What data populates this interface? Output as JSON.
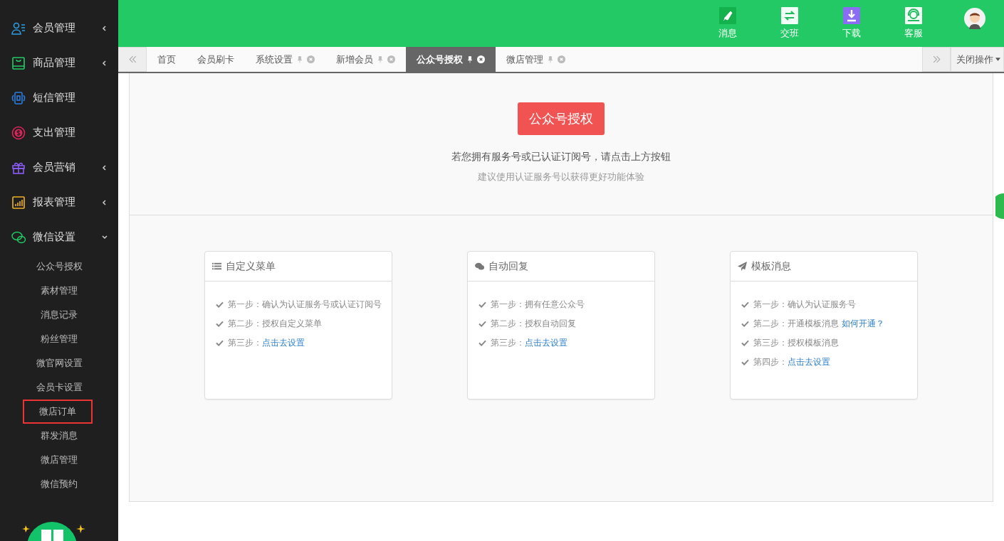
{
  "sidebar": {
    "items": [
      {
        "label": "会员管理",
        "submenu": true,
        "expanded": false
      },
      {
        "label": "商品管理",
        "submenu": true,
        "expanded": false
      },
      {
        "label": "短信管理",
        "submenu": false
      },
      {
        "label": "支出管理",
        "submenu": false
      },
      {
        "label": "会员营销",
        "submenu": true,
        "expanded": false
      },
      {
        "label": "报表管理",
        "submenu": true,
        "expanded": false
      },
      {
        "label": "微信设置",
        "submenu": true,
        "expanded": true,
        "children": [
          {
            "label": "公众号授权",
            "highlighted": false
          },
          {
            "label": "素材管理",
            "highlighted": false
          },
          {
            "label": "消息记录",
            "highlighted": false
          },
          {
            "label": "粉丝管理",
            "highlighted": false
          },
          {
            "label": "微官网设置",
            "highlighted": false
          },
          {
            "label": "会员卡设置",
            "highlighted": false
          },
          {
            "label": "微店订单",
            "highlighted": true
          },
          {
            "label": "群发消息",
            "highlighted": false
          },
          {
            "label": "微店管理",
            "highlighted": false
          },
          {
            "label": "微信预约",
            "highlighted": false
          }
        ]
      }
    ]
  },
  "topbar": {
    "actions": [
      {
        "label": "消息"
      },
      {
        "label": "交班"
      },
      {
        "label": "下载"
      },
      {
        "label": "客服"
      }
    ]
  },
  "tabs": [
    {
      "label": "首页",
      "selected": false,
      "closable": false
    },
    {
      "label": "会员刷卡",
      "selected": false,
      "closable": false
    },
    {
      "label": "系统设置",
      "selected": false,
      "closable": true
    },
    {
      "label": "新增会员",
      "selected": false,
      "closable": true
    },
    {
      "label": "公众号授权",
      "selected": true,
      "closable": true
    },
    {
      "label": "微店管理",
      "selected": false,
      "closable": true
    }
  ],
  "close_menu": "关闭操作",
  "auth": {
    "button": "公众号授权",
    "hint": "若您拥有服务号或已认证订阅号，请点击上方按钮",
    "note": "建议使用认证服务号以获得更好功能体验"
  },
  "cards": [
    {
      "title": "自定义菜单",
      "steps": [
        {
          "text": "第一步：确认为认证服务号或认证订阅号"
        },
        {
          "text": "第二步：授权自定义菜单"
        },
        {
          "text": "第三步：",
          "link": "点击去设置"
        }
      ]
    },
    {
      "title": "自动回复",
      "steps": [
        {
          "text": "第一步：拥有任意公众号"
        },
        {
          "text": "第二步：授权自动回复"
        },
        {
          "text": "第三步：",
          "link": "点击去设置"
        }
      ]
    },
    {
      "title": "模板消息",
      "steps": [
        {
          "text": "第一步：确认为认证服务号"
        },
        {
          "text": "第二步：开通模板消息",
          "link": "如何开通？"
        },
        {
          "text": "第三步：授权模板消息"
        },
        {
          "text": "第四步：",
          "link": "点击去设置"
        }
      ]
    }
  ]
}
